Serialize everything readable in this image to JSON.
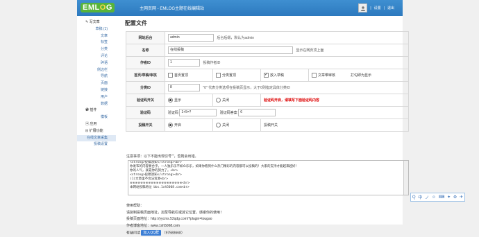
{
  "header": {
    "logo": "EMLOG",
    "site_links": "主网页网 - EMLOG主题在线编辑站",
    "settings": "设置",
    "logout": "退出"
  },
  "sidebar": {
    "items": [
      {
        "label": "写文章",
        "group": true
      },
      {
        "label": "草稿 (1)"
      },
      {
        "label": "文章"
      },
      {
        "label": "标签"
      },
      {
        "label": "分类"
      },
      {
        "label": "评论"
      },
      {
        "label": "碎语"
      },
      {
        "label": "侧边栏"
      },
      {
        "label": "导航"
      },
      {
        "label": "页面"
      },
      {
        "label": "链接"
      },
      {
        "label": "用户"
      },
      {
        "label": "数据"
      },
      {
        "label": "插件",
        "group": true
      },
      {
        "label": "模板"
      },
      {
        "label": "应用",
        "group": true
      },
      {
        "label": "扩展功能",
        "group": true
      },
      {
        "label": "在线文章采集",
        "active": true
      },
      {
        "label": "投稿设置"
      }
    ]
  },
  "main": {
    "title": "配置文件",
    "rows": {
      "backend": {
        "label": "网站后台",
        "value": "admin",
        "hint": "后台后缀，默认为admin"
      },
      "name": {
        "label": "名称",
        "value": "在线投稿",
        "hint": "显示在网页顶上面"
      },
      "author": {
        "label": "作者ID",
        "value": "1",
        "hint": "投稿作者ID"
      },
      "display": {
        "label": "首页/草稿/审核",
        "options": [
          "首页置顶",
          "分类置顶",
          "放入草稿",
          "文章带审核"
        ],
        "checked": [
          false,
          false,
          true,
          false
        ],
        "hint": "打勾即为显示"
      },
      "category": {
        "label": "分类ID",
        "value": "8",
        "hint": "\"0\" 代表分类选项在投稿页显示，大于0则指定具体分类ID"
      },
      "captcha_switch": {
        "label": "验证码开关",
        "on": "显示",
        "off": "关闭",
        "warn": "验证码开启，请填写下面验证码内容"
      },
      "captcha": {
        "label": "验证码",
        "q_label": "验证码",
        "q_value": "1+5=？",
        "a_label": "验证码答案",
        "a_value": "6"
      },
      "submit_switch": {
        "label": "投稿开关",
        "on": "开启",
        "off": "关闭",
        "hint": "投稿开关"
      }
    },
    "note": {
      "head": "注意事项：以下不能出现引号\"\"，否则会出错。",
      "lines": [
        "<strong>投稿须知</strong><br>",
        "你发布的内容要合乎。一人独乐乐不如众乐乐，如果你看到什么热门精彩的内容都可以投稿的！大家的支持才能越来越好！",
        "你的人气，就靠你的努力了。<br>",
        "<strong>投稿须知</strong><br>",
        "(1)文章里不合法资源<br>",
        "※※※※※※※※※※※※※※※※※※※※<br>",
        "本网站投稿地址 bbs.1xh5068.com<br>"
      ]
    },
    "help": {
      "head": "使用帮助：",
      "line1": "请复制投稿页面地址，加至导航栏或其它位置，感谢你的使用！",
      "line2": "投稿页面地址：http://yycms.52qdg.com/?plugin=tougao",
      "line3": "作者博客地址：www.1xh5068.com",
      "line4_label": "有疑问请",
      "qq_button": "加入QQ群",
      "qq_number": "（97588668）"
    }
  },
  "ime": {
    "items": [
      "Q",
      "中",
      "ノ",
      "☺",
      "⌨",
      "✦",
      "⚙",
      "✈"
    ]
  }
}
